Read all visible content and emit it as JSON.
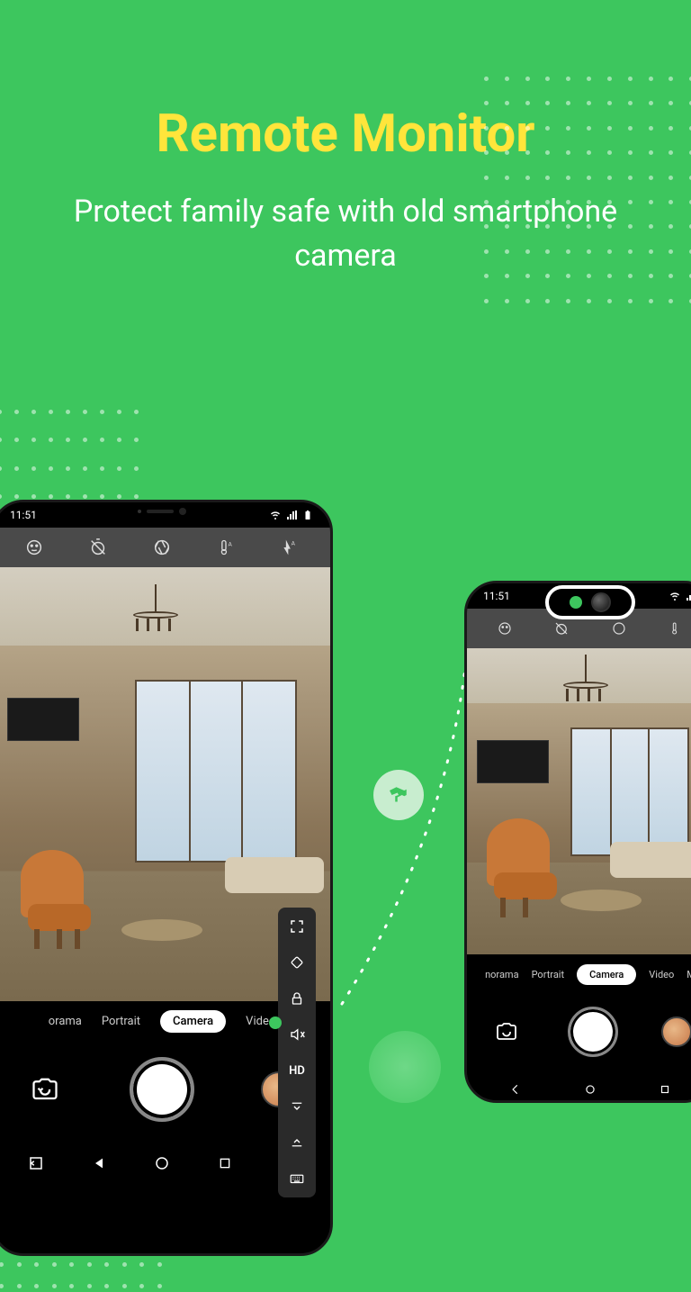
{
  "title": "Remote Monitor",
  "subtitle": "Protect family safe with old smartphone camera",
  "status_time": "11:51",
  "modes": {
    "panorama": "orama",
    "panorama_r": "norama",
    "portrait": "Portrait",
    "camera": "Camera",
    "video": "Video",
    "more_r": "M"
  },
  "floatmenu": {
    "hd": "HD"
  }
}
